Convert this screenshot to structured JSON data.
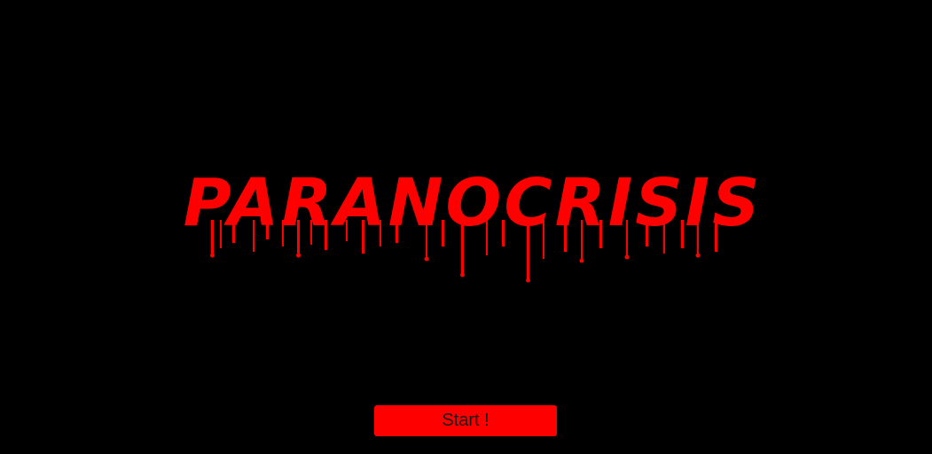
{
  "game": {
    "title": "PARANOCRISIS",
    "start_label": "Start !"
  },
  "colors": {
    "background": "#000000",
    "accent": "#ff0000",
    "button_text": "#1a1a1a"
  }
}
